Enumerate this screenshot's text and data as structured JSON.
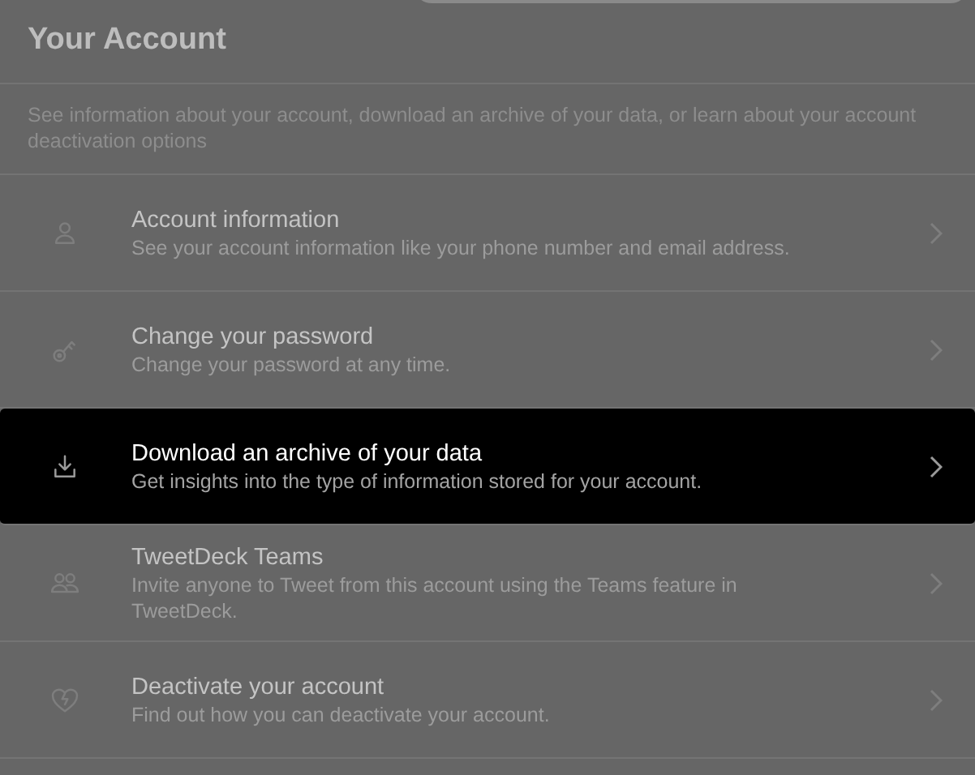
{
  "header": {
    "title": "Your Account",
    "description": "See information about your account, download an archive of your data, or learn about your account deactivation options"
  },
  "items": [
    {
      "title": "Account information",
      "description": "See your account information like your phone number and email address.",
      "selected": false
    },
    {
      "title": "Change your password",
      "description": "Change your password at any time.",
      "selected": false
    },
    {
      "title": "Download an archive of your data",
      "description": "Get insights into the type of information stored for your account.",
      "selected": true
    },
    {
      "title": "TweetDeck Teams",
      "description": "Invite anyone to Tweet from this account using the Teams feature in TweetDeck.",
      "selected": false
    },
    {
      "title": "Deactivate your account",
      "description": "Find out how you can deactivate your account.",
      "selected": false
    }
  ]
}
